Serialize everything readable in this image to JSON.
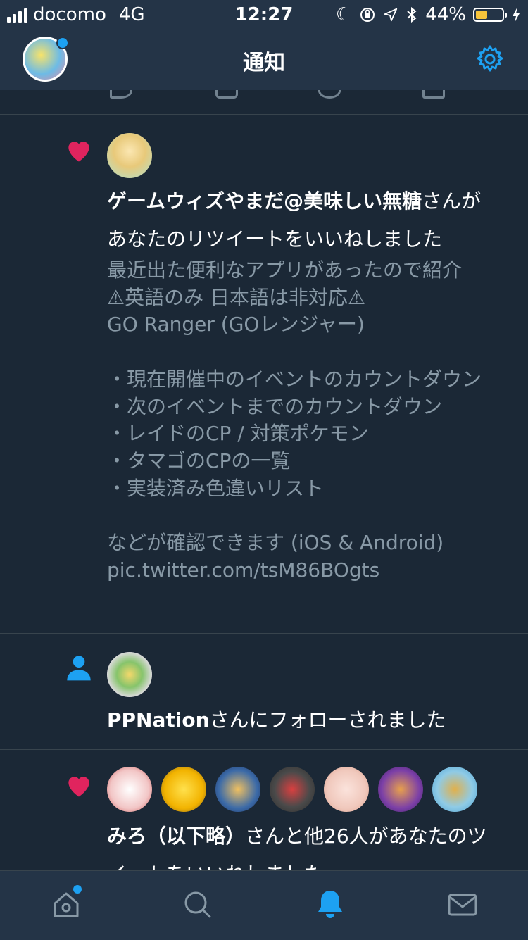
{
  "status_bar": {
    "carrier": "docomo",
    "network": "4G",
    "time": "12:27",
    "battery": "44%",
    "battery_level": 0.44
  },
  "nav": {
    "title": "通知"
  },
  "notifications": [
    {
      "type": "like",
      "user_name": "ゲームウィズやまだ@美味しい無糖",
      "line1_suffix": "さんが",
      "line2": "あなたのリツイートをいいねしました",
      "body": "最近出た便利なアプリがあったので紹介\n⚠英語のみ 日本語は非対応⚠\nGO Ranger (GOレンジャー)\n\n・現在開催中のイベントのカウントダウン\n・次のイベントまでのカウントダウン\n・レイドのCP / 対策ポケモン\n・タマゴのCPの一覧\n・実装済み色違いリスト\n\nなどが確認できます (iOS & Android)\npic.twitter.com/tsM86BOgts"
    },
    {
      "type": "follow",
      "user_name": "PPNation",
      "suffix": "さんにフォローされました"
    },
    {
      "type": "like",
      "user_name": "みろ（以下略）",
      "suffix": "さんと他26人があなたのツ",
      "line2": "イートをいいねしました"
    }
  ],
  "colors": {
    "background": "#1b2836",
    "bar": "#243447",
    "accent": "#1da1f2",
    "like": "#e0245e",
    "muted": "#8899a6"
  },
  "tabs": [
    {
      "icon": "home-icon"
    },
    {
      "icon": "search-icon"
    },
    {
      "icon": "bell-icon",
      "active": true
    },
    {
      "icon": "mail-icon"
    }
  ]
}
